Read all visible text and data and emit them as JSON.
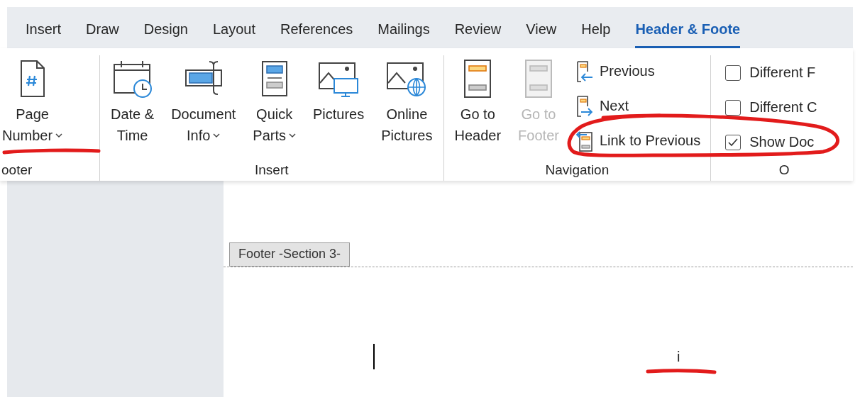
{
  "tabs": [
    {
      "label": "Insert",
      "selected": false
    },
    {
      "label": "Draw",
      "selected": false
    },
    {
      "label": "Design",
      "selected": false
    },
    {
      "label": "Layout",
      "selected": false
    },
    {
      "label": "References",
      "selected": false
    },
    {
      "label": "Mailings",
      "selected": false
    },
    {
      "label": "Review",
      "selected": false
    },
    {
      "label": "View",
      "selected": false
    },
    {
      "label": "Help",
      "selected": false
    },
    {
      "label": "Header & Foote",
      "selected": true
    }
  ],
  "ribbon_groups": [
    {
      "label": "ooter",
      "items": [
        {
          "kind": "large",
          "lines": [
            "Page",
            "Number"
          ],
          "dropdown": true,
          "disabled": false
        }
      ]
    },
    {
      "label": "Insert",
      "items": [
        {
          "kind": "large",
          "lines": [
            "Date &",
            "Time"
          ],
          "dropdown": false,
          "disabled": false
        },
        {
          "kind": "large",
          "lines": [
            "Document",
            "Info"
          ],
          "dropdown": true,
          "disabled": false
        },
        {
          "kind": "large",
          "lines": [
            "Quick",
            "Parts"
          ],
          "dropdown": true,
          "disabled": false
        },
        {
          "kind": "large",
          "lines": [
            "Pictures"
          ],
          "dropdown": false,
          "disabled": false
        },
        {
          "kind": "large",
          "lines": [
            "Online",
            "Pictures"
          ],
          "dropdown": false,
          "disabled": false
        }
      ]
    },
    {
      "label": "Navigation",
      "items": [
        {
          "kind": "large",
          "lines": [
            "Go to",
            "Header"
          ],
          "dropdown": false,
          "disabled": false
        },
        {
          "kind": "large",
          "lines": [
            "Go to",
            "Footer"
          ],
          "dropdown": false,
          "disabled": true
        },
        {
          "kind": "stack",
          "buttons": [
            {
              "label": "Previous"
            },
            {
              "label": "Next"
            },
            {
              "label": "Link to Previous"
            }
          ]
        }
      ]
    },
    {
      "label": "O",
      "items": [
        {
          "kind": "checks",
          "checks": [
            {
              "label": "Different F",
              "checked": false
            },
            {
              "label": "Different C",
              "checked": false
            },
            {
              "label": "Show Doc",
              "checked": true
            }
          ]
        }
      ]
    }
  ],
  "document": {
    "footer_tag": "Footer -Section 3-",
    "footer_text": "i"
  }
}
